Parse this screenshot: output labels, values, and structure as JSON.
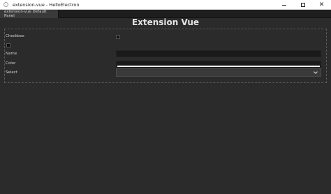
{
  "window": {
    "title": "extension-vue - HelloElectron",
    "icon": "app-icon",
    "controls": [
      "minimize-icon",
      "maximize-icon",
      "close-icon"
    ]
  },
  "tabs": [
    {
      "label": "extension-vue Default Panel",
      "active": true
    }
  ],
  "panel": {
    "title": "Extension Vue",
    "fields": {
      "checkbox_label": "Checkbox",
      "checkbox_checked": false,
      "standalone_checkbox_checked": false,
      "name_label": "Name",
      "name_value": "",
      "color_label": "Color",
      "color_value": "#ffffff",
      "select_label": "Select",
      "select_value": ""
    }
  },
  "colors": {
    "background": "#2b2b2b",
    "titlebar": "#ffffff",
    "tab_active": "#3a3a3a",
    "input_bg": "#1a1a1a"
  }
}
